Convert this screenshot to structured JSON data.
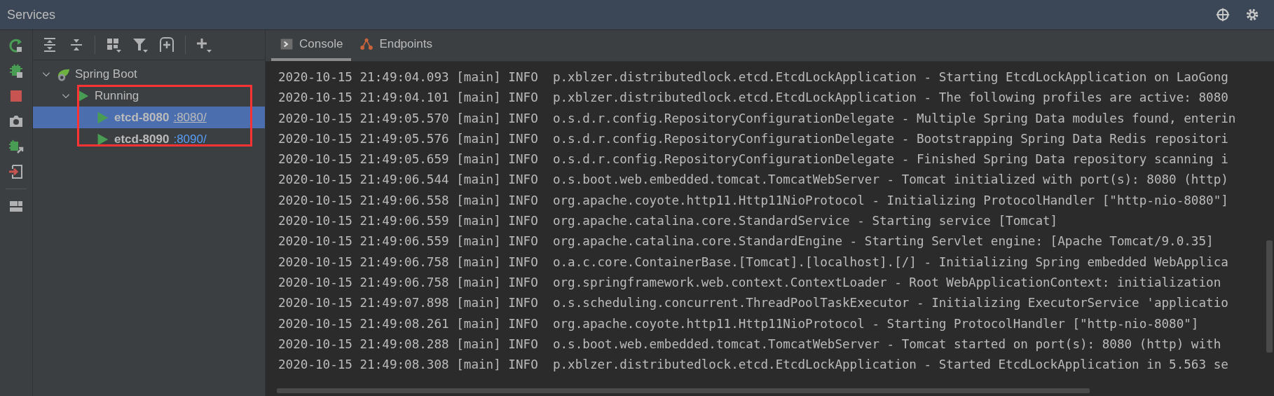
{
  "window": {
    "title": "Services"
  },
  "side_toolbar": [
    {
      "kind": "rerun"
    },
    {
      "kind": "debug"
    },
    {
      "kind": "stop"
    },
    {
      "kind": "camera"
    },
    {
      "kind": "attach"
    },
    {
      "kind": "import"
    },
    {
      "kind": "layout"
    }
  ],
  "tree_toolbar": [
    {
      "kind": "expand"
    },
    {
      "kind": "collapse"
    },
    {
      "kind": "group"
    },
    {
      "kind": "filter"
    },
    {
      "kind": "add-service"
    },
    {
      "kind": "add"
    }
  ],
  "tree": [
    {
      "label": "Spring Boot",
      "kind": "spring",
      "expanded": true,
      "selected": false,
      "children": [
        {
          "label": "Running",
          "kind": "running",
          "expanded": true,
          "selected": false,
          "children": [
            {
              "label": "etcd-8080",
              "link": ":8080/",
              "kind": "app",
              "selected": true
            },
            {
              "label": "etcd-8090",
              "link": ":8090/",
              "kind": "app",
              "selected": false
            }
          ]
        }
      ]
    }
  ],
  "tabs": [
    {
      "label": "Console",
      "kind": "console",
      "selected": true
    },
    {
      "label": "Endpoints",
      "kind": "endpoints",
      "selected": false
    }
  ],
  "console_lines": [
    "2020-10-15 21:49:04.093 [main] INFO  p.xblzer.distributedlock.etcd.EtcdLockApplication - Starting EtcdLockApplication on LaoGong",
    "2020-10-15 21:49:04.101 [main] INFO  p.xblzer.distributedlock.etcd.EtcdLockApplication - The following profiles are active: 8080",
    "2020-10-15 21:49:05.570 [main] INFO  o.s.d.r.config.RepositoryConfigurationDelegate - Multiple Spring Data modules found, enterin",
    "2020-10-15 21:49:05.576 [main] INFO  o.s.d.r.config.RepositoryConfigurationDelegate - Bootstrapping Spring Data Redis repositori",
    "2020-10-15 21:49:05.659 [main] INFO  o.s.d.r.config.RepositoryConfigurationDelegate - Finished Spring Data repository scanning i",
    "2020-10-15 21:49:06.544 [main] INFO  o.s.boot.web.embedded.tomcat.TomcatWebServer - Tomcat initialized with port(s): 8080 (http)",
    "2020-10-15 21:49:06.558 [main] INFO  org.apache.coyote.http11.Http11NioProtocol - Initializing ProtocolHandler [\"http-nio-8080\"]",
    "2020-10-15 21:49:06.559 [main] INFO  org.apache.catalina.core.StandardService - Starting service [Tomcat]",
    "2020-10-15 21:49:06.559 [main] INFO  org.apache.catalina.core.StandardEngine - Starting Servlet engine: [Apache Tomcat/9.0.35]",
    "2020-10-15 21:49:06.758 [main] INFO  o.a.c.core.ContainerBase.[Tomcat].[localhost].[/] - Initializing Spring embedded WebApplica",
    "2020-10-15 21:49:06.758 [main] INFO  org.springframework.web.context.ContextLoader - Root WebApplicationContext: initialization",
    "2020-10-15 21:49:07.898 [main] INFO  o.s.scheduling.concurrent.ThreadPoolTaskExecutor - Initializing ExecutorService 'applicatio",
    "2020-10-15 21:49:08.261 [main] INFO  org.apache.coyote.http11.Http11NioProtocol - Starting ProtocolHandler [\"http-nio-8080\"]",
    "2020-10-15 21:49:08.288 [main] INFO  o.s.boot.web.embedded.tomcat.TomcatWebServer - Tomcat started on port(s): 8080 (http) with",
    "2020-10-15 21:49:08.308 [main] INFO  p.xblzer.distributedlock.etcd.EtcdLockApplication - Started EtcdLockApplication in 5.563 se"
  ]
}
